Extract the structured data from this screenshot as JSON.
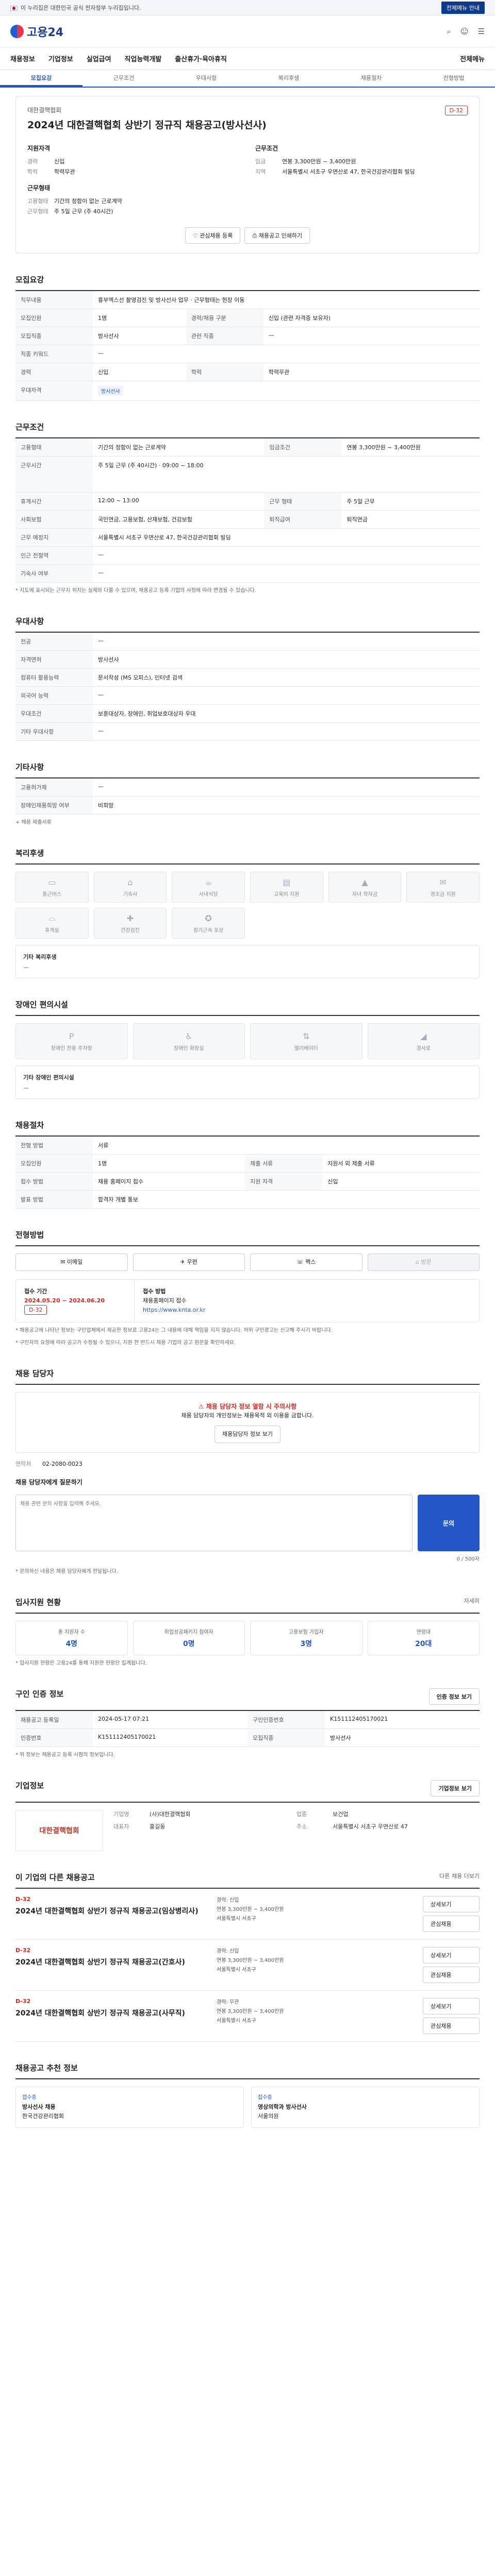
{
  "gov_bar": {
    "left": "이 누리집은 대한민국 공식 전자정부 누리집입니다.",
    "right": "전체메뉴 안내"
  },
  "brand": "고용24",
  "header_icons": [
    "search-icon",
    "user-icon",
    "menu-icon"
  ],
  "gnb": [
    "채용정보",
    "기업정보",
    "실업급여",
    "직업능력개발",
    "출산휴가·육아휴직"
  ],
  "gnb_right": "전체메뉴",
  "subtabs": [
    "모집요강",
    "근무조건",
    "우대사항",
    "복리후생",
    "채용절차",
    "전형방법"
  ],
  "summary": {
    "company": "대한결핵협회",
    "title": "2024년 대한결핵협회 상반기 정규직 채용공고(방사선사)",
    "dday": "D-32",
    "left_title": "지원자격",
    "left": [
      {
        "k": "경력",
        "v": "신입"
      },
      {
        "k": "학력",
        "v": "학력무관"
      }
    ],
    "left_title2": "근무형태",
    "left2": [
      {
        "k": "고용형태",
        "v": "기간의 정함이 없는 근로계약"
      },
      {
        "k": "근무형태",
        "v": "주 5일 근무 (주 40시간)"
      }
    ],
    "right_title": "근무조건",
    "right": [
      {
        "k": "임금",
        "v": "연봉 3,300만원 ~ 3,400만원"
      },
      {
        "k": "지역",
        "v": "서울특별시 서초구 우면산로 47, 한국건강관리협회 빌딩"
      }
    ],
    "btn_scrap": "관심채용 등록",
    "btn_print": "채용공고 인쇄하기"
  },
  "recruit": {
    "title": "모집요강",
    "duty_label": "직무내용",
    "duty": "흉부엑스선 촬영검진 및 방사선사 업무 · 근무형태는 현장 이동",
    "rows": [
      {
        "k": "모집인원",
        "v": "1명",
        "k2": "경력/채용 구분",
        "v2": "신입 (관련 자격증 보유자)"
      },
      {
        "k": "모집직종",
        "v": "방사선사",
        "k2": "관련 직종",
        "v2": "—"
      },
      {
        "k": "직종 키워드",
        "v": "—",
        "k2": "",
        "v2": ""
      },
      {
        "k": "경력",
        "v": "신입",
        "k2": "학력",
        "v2": "학력무관"
      },
      {
        "k": "우대자격",
        "v": "방사선사",
        "k2": "",
        "v2": ""
      }
    ]
  },
  "work": {
    "title": "근무조건",
    "rows": [
      {
        "k": "고용형태",
        "v": "기간의 정함이 없는 근로계약",
        "k2": "임금조건",
        "v2": "연봉 3,300만원 ~ 3,400만원"
      },
      {
        "k": "근무시간",
        "v": "주 5일 근무 (주 40시간) · 09:00 ~ 18:00",
        "k2": "",
        "v2": ""
      },
      {
        "k": "휴게시간",
        "v": "12:00 ~ 13:00",
        "k2": "근무 형태",
        "v2": "주 5일 근무"
      },
      {
        "k": "사회보험",
        "v": "국민연금, 고용보험, 산재보험, 건강보험",
        "k2": "퇴직급여",
        "v2": "퇴직연금"
      },
      {
        "k": "근무 예정지",
        "v": "서울특별시 서초구 우면산로 47, 한국건강관리협회 빌딩",
        "k2": "",
        "v2": ""
      },
      {
        "k": "인근 전철역",
        "v": "—",
        "k2": "",
        "v2": ""
      },
      {
        "k": "기숙사 여부",
        "v": "—",
        "k2": "",
        "v2": ""
      }
    ],
    "note": "* 지도에 표시되는 근무지 위치는 실제와 다를 수 있으며, 채용공고 등록 기업의 사정에 따라 변경될 수 있습니다."
  },
  "prefer": {
    "title": "우대사항",
    "rows": [
      {
        "k": "전공",
        "v": "—"
      },
      {
        "k": "자격면허",
        "v": "방사선사"
      },
      {
        "k": "컴퓨터 활용능력",
        "v": "문서작성 (MS 오피스), 인터넷 검색"
      },
      {
        "k": "외국어 능력",
        "v": "—"
      },
      {
        "k": "우대조건",
        "v": "보훈대상자, 장애인, 취업보호대상자 우대"
      },
      {
        "k": "기타 우대사항",
        "v": "—"
      }
    ]
  },
  "etc": {
    "title": "기타사항",
    "rows": [
      {
        "k": "고용허가제",
        "v": "—"
      },
      {
        "k": "장애인채용희망 여부",
        "v": "비희망"
      }
    ],
    "extra": "+ 채용 제출서류"
  },
  "welfare": {
    "title": "복리후생",
    "items": [
      "통근버스",
      "기숙사",
      "사내식당",
      "교육비 지원",
      "자녀 학자금",
      "경조금 지원",
      "휴게실",
      "건강검진",
      "장기근속 포상"
    ],
    "free_label": "기타 복리후생",
    "free_value": "—"
  },
  "disabled": {
    "title": "장애인 편의시설",
    "items": [
      "장애인 전용 주차장",
      "장애인 화장실",
      "엘리베이터",
      "경사로"
    ],
    "free_label": "기타 장애인 편의시설",
    "free_value": "—"
  },
  "process": {
    "title": "채용절차",
    "rows": [
      {
        "k": "전형 방법",
        "v": "서류",
        "k2": "",
        "v2": ""
      },
      {
        "k": "모집인원",
        "v": "1명",
        "k2": "제출 서류",
        "v2": "지원서 외 제출 서류"
      },
      {
        "k": "접수 방법",
        "v": "채용 홈페이지 접수",
        "k2": "지원 자격",
        "v2": "신입"
      },
      {
        "k": "발표 방법",
        "v": "합격자 개별 통보",
        "k2": "",
        "v2": ""
      }
    ]
  },
  "apply": {
    "title": "전형방법",
    "methods": [
      "이메일",
      "우편",
      "팩스",
      "방문"
    ],
    "period_label": "접수 기간",
    "period": "2024.05.20 ~ 2024.06.20",
    "dday": "D-32",
    "apply_label": "접수 방법",
    "apply_value": "채용홈페이지 접수",
    "url": "https://www.knta.or.kr",
    "note": "* 채용공고에 나타난 정보는 구인업체에서 제공한 정보로 고용24는 그 내용에 대해 책임을 지지 않습니다. 허위 구인광고는 신고해 주시기 바랍니다.",
    "note2": "* 구인자의 요청에 따라 공고가 수정될 수 있으니, 지원 전 반드시 채용 기업의 공고 원문을 확인하세요."
  },
  "qna": {
    "title": "채용 담당자",
    "alert": "채용 담당자 정보 열람 시 주의사항",
    "desc": "채용 담당자의 개인정보는 채용목적 외 이용을 금합니다.",
    "btn": "채용담당자 정보 보기",
    "contact_label": "연락처",
    "contact": "02-2080-0023",
    "form_label": "채용 담당자에게 질문하기",
    "placeholder": "채용 관련 문의 사항을 입력해 주세요.",
    "send": "문의",
    "counter": "0 / 500자",
    "note": "* 문의하신 내용은 채용 담당자에게 전달됩니다."
  },
  "status": {
    "title": "입사지원 현황",
    "more": "자세히",
    "stats": [
      {
        "label": "총 지원자 수",
        "value": "4명"
      },
      {
        "label": "취업성공패키지 참여자",
        "value": "0명"
      },
      {
        "label": "고용보험 가입자",
        "value": "3명"
      },
      {
        "label": "연령대",
        "value": "20대"
      }
    ],
    "note": "* 입사지원 현황은 고용24를 통해 지원한 현황만 집계됩니다."
  },
  "info": {
    "title": "구인 인증 정보",
    "btn": "인증 정보 보기",
    "rows": [
      {
        "k": "채용공고 등록일",
        "v": "2024-05-17 07:21",
        "k2": "구인인증번호",
        "v2": "K151112405170021"
      },
      {
        "k": "인증번호",
        "v": "K151112405170021",
        "k2": "모집직종",
        "v2": "방사선사"
      }
    ],
    "note": "* 위 정보는 채용공고 등록 시점의 정보입니다."
  },
  "company": {
    "title": "기업정보",
    "more": "기업정보 보기",
    "logo_text": "대한결핵협회",
    "rows": [
      {
        "k": "기업명",
        "v": "(사)대한결핵협회"
      },
      {
        "k": "업종",
        "v": "보건업"
      },
      {
        "k": "대표자",
        "v": "홍길동"
      },
      {
        "k": "주소",
        "v": "서울특별시 서초구 우면산로 47"
      }
    ]
  },
  "jobs": {
    "title": "이 기업의 다른 채용공고",
    "more": "다른 채용 더보기",
    "list": [
      {
        "date": "D-32",
        "title": "2024년 대한결핵협회 상반기 정규직 채용공고(임상병리사)",
        "i1": "경력: 신입",
        "i2": "연봉 3,300만원 ~ 3,400만원",
        "i3": "서울특별시 서초구"
      },
      {
        "date": "D-32",
        "title": "2024년 대한결핵협회 상반기 정규직 채용공고(간호사)",
        "i1": "경력: 신입",
        "i2": "연봉 3,300만원 ~ 3,400만원",
        "i3": "서울특별시 서초구"
      },
      {
        "date": "D-32",
        "title": "2024년 대한결핵협회 상반기 정규직 채용공고(사무직)",
        "i1": "경력: 무관",
        "i2": "연봉 3,300만원 ~ 3,400만원",
        "i3": "서울특별시 서초구"
      }
    ],
    "btn_detail": "상세보기",
    "btn_scrap": "관심채용"
  },
  "recommend": {
    "title": "채용공고 추천 정보",
    "items": [
      {
        "status": "접수중",
        "title": "방사선사 채용",
        "company": "한국건강관리협회"
      },
      {
        "status": "접수중",
        "title": "영상의학과 방사선사",
        "company": "서울의원"
      }
    ]
  }
}
